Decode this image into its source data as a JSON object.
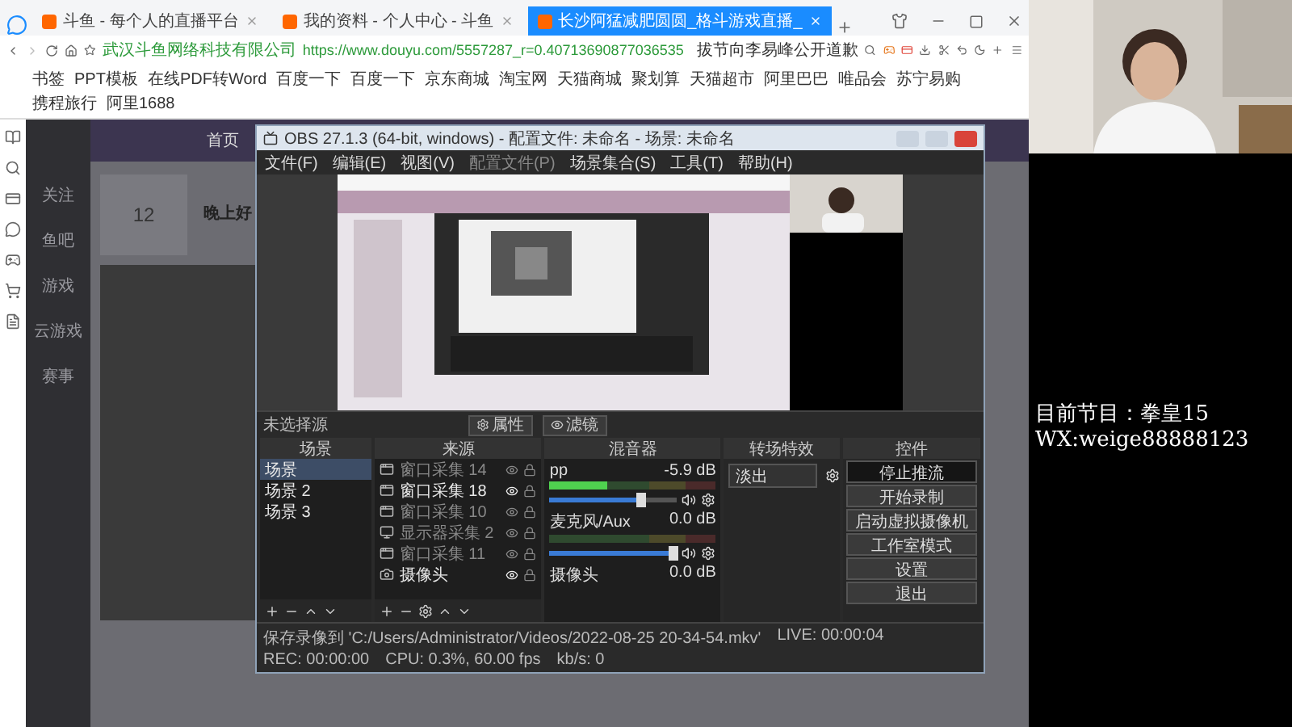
{
  "browser": {
    "tabs": [
      {
        "title": "斗鱼 - 每个人的直播平台",
        "selected": false
      },
      {
        "title": "我的资料 - 个人中心 - 斗鱼",
        "selected": false
      },
      {
        "title": "长沙阿猛减肥圆圆_格斗游戏直播_",
        "selected": true
      }
    ],
    "company": "武汉斗鱼网络科技有限公司",
    "url": "https://www.douyu.com/5557287_r=0.40713690877036535",
    "search": {
      "value": "拔节向李易峰公开道歉"
    },
    "bookmarks": [
      "书签",
      "PPT模板",
      "在线PDF转Word",
      "百度一下",
      "百度一下",
      "京东商城",
      "淘宝网",
      "天猫商城",
      "聚划算",
      "天猫超市",
      "阿里巴巴",
      "唯品会",
      "苏宁易购",
      "携程旅行",
      "阿里1688"
    ]
  },
  "page": {
    "home": "首页",
    "sidebar": [
      "关注",
      "鱼吧",
      "游戏",
      "云游戏",
      "赛事"
    ],
    "stat": "12",
    "greeting": "晚上好"
  },
  "obs": {
    "title": "OBS 27.1.3 (64-bit, windows) - 配置文件: 未命名 - 场景: 未命名",
    "menu": [
      "文件(F)",
      "编辑(E)",
      "视图(V)",
      "配置文件(P)",
      "场景集合(S)",
      "工具(T)",
      "帮助(H)"
    ],
    "source_bar": {
      "label": "未选择源",
      "buttons": [
        "属性",
        "滤镜"
      ]
    },
    "scenes": {
      "title": "场景",
      "items": [
        {
          "name": "场景",
          "selected": true
        },
        {
          "name": "场景 2",
          "selected": false
        },
        {
          "name": "场景 3",
          "selected": false
        }
      ]
    },
    "sources": {
      "title": "来源",
      "items": [
        {
          "name": "窗口采集 14",
          "kind": "window",
          "visible": false
        },
        {
          "name": "窗口采集 18",
          "kind": "window",
          "visible": true
        },
        {
          "name": "窗口采集 10",
          "kind": "window",
          "visible": false
        },
        {
          "name": "显示器采集 2",
          "kind": "display",
          "visible": false
        },
        {
          "name": "窗口采集 11",
          "kind": "window",
          "visible": false
        },
        {
          "name": "摄像头",
          "kind": "camera",
          "visible": true
        }
      ]
    },
    "mixer": {
      "title": "混音器",
      "channels": [
        {
          "name": "pp",
          "reading": "-5.9 dB",
          "meter": {
            "level": 0.35
          },
          "volume": {
            "level": 0.72
          }
        },
        {
          "name": "麦克风/Aux",
          "reading": "0.0 dB",
          "volume": {
            "level": 0.97
          }
        },
        {
          "name": "摄像头",
          "reading": "0.0 dB"
        }
      ]
    },
    "transitions": {
      "title": "转场特效",
      "value": "淡出"
    },
    "controls": {
      "title": "控件",
      "buttons": [
        {
          "label": "停止推流",
          "active": true
        },
        {
          "label": "开始录制",
          "active": false
        },
        {
          "label": "启动虚拟摄像机",
          "active": false
        },
        {
          "label": "工作室模式",
          "active": false
        },
        {
          "label": "设置",
          "active": false
        },
        {
          "label": "退出",
          "active": false
        }
      ]
    },
    "status": {
      "path": "保存录像到 'C:/Users/Administrator/Videos/2022-08-25 20-34-54.mkv'",
      "live": "LIVE: 00:00:04",
      "rec": "REC: 00:00:00",
      "cpu": "CPU: 0.3%, 60.00 fps",
      "bitrate": "kb/s: 0"
    }
  },
  "overlay": {
    "program": "目前节目：拳皇15",
    "contact": "WX:weige88888123"
  }
}
